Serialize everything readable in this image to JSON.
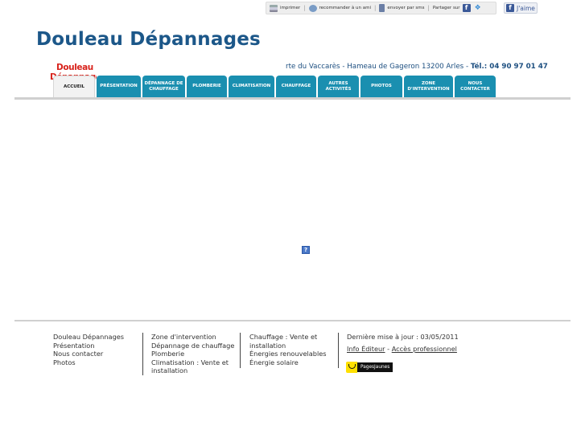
{
  "toolbar": {
    "print_label": "imprimer",
    "recommend_label": "recommander à un ami",
    "sms_label": "envoyer par sms",
    "share_label": "Partager sur",
    "like_label": "J'aime"
  },
  "header": {
    "title": "Douleau Dépannages",
    "logo_line1": "Douleau",
    "logo_line2": "Dépannages",
    "address": "rte du Vaccarès - Hameau de Gageron 13200 Arles  - ",
    "phone": "Tél.: 04 90 97 01 47"
  },
  "nav": {
    "tabs": [
      {
        "label": "ACCUEIL"
      },
      {
        "label": "PRÉSENTATION"
      },
      {
        "label": "DÉPANNAGE DE CHAUFFAGE"
      },
      {
        "label": "PLOMBERIE"
      },
      {
        "label": "CLIMATISATION"
      },
      {
        "label": "CHAUFFAGE"
      },
      {
        "label": "AUTRES ACTIVITÉS"
      },
      {
        "label": "PHOTOS"
      },
      {
        "label": "ZONE D'INTERVENTION"
      },
      {
        "label": "NOUS CONTACTER"
      }
    ],
    "active_color": "#f2f2f2",
    "tab_color": "#1a8fb0"
  },
  "plugin": {
    "glyph": "?"
  },
  "footer": {
    "col1": [
      "Douleau Dépannages",
      "Présentation",
      "Nous contacter",
      "Photos"
    ],
    "col2": [
      "Zone d'intervention",
      "Dépannage de chauffage",
      "Plomberie",
      "Climatisation : Vente et installation"
    ],
    "col3": [
      "Chauffage : Vente et installation",
      "Énergies renouvelables",
      "Énergie solaire"
    ],
    "updated": "Dernière mise à jour : 03/05/2011",
    "info_editeur": "Info Éditeur",
    "link_sep": " - ",
    "acces_pro": "Accès professionnel",
    "pages_jaunes": "PagesJaunes"
  },
  "colors": {
    "title": "#1c5789",
    "logo": "#d8231c",
    "address": "#1d4f80"
  }
}
